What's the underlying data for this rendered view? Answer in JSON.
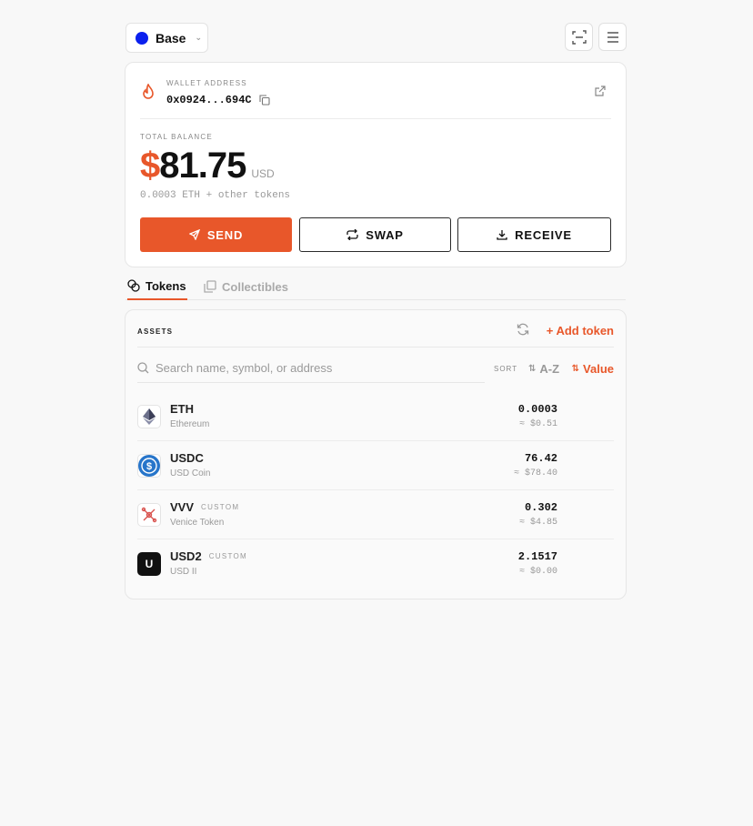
{
  "network": {
    "name": "Base",
    "color": "#0b20ee",
    "chevron_icon": "chevron-down-icon"
  },
  "toolbar": {
    "scan_icon": "scan-icon",
    "menu_icon": "menu-icon"
  },
  "wallet": {
    "address_label": "WALLET ADDRESS",
    "address": "0x0924...694C",
    "balance_label": "TOTAL BALANCE",
    "balance_symbol": "$",
    "balance_amount": "81.75",
    "balance_currency": "USD",
    "balance_sub": "0.0003 ETH + other tokens"
  },
  "actions": {
    "send": "SEND",
    "swap": "SWAP",
    "receive": "RECEIVE"
  },
  "tabs": [
    {
      "label": "Tokens",
      "active": true
    },
    {
      "label": "Collectibles",
      "active": false
    }
  ],
  "assets": {
    "title": "ASSETS",
    "add_token": "+ Add token",
    "search_placeholder": "Search name, symbol, or address",
    "sort_label": "SORT",
    "sort_az": "A-Z",
    "sort_value": "Value",
    "tokens": [
      {
        "symbol": "ETH",
        "name": "Ethereum",
        "amount": "0.0003",
        "usd": "≈ $0.51",
        "custom": ""
      },
      {
        "symbol": "USDC",
        "name": "USD Coin",
        "amount": "76.42",
        "usd": "≈ $78.40",
        "custom": ""
      },
      {
        "symbol": "VVV",
        "name": "Venice Token",
        "amount": "0.302",
        "usd": "≈ $4.85",
        "custom": "CUSTOM"
      },
      {
        "symbol": "USD2",
        "name": "USD II",
        "amount": "2.1517",
        "usd": "≈ $0.00",
        "custom": "CUSTOM",
        "icon_letter": "U"
      }
    ]
  },
  "colors": {
    "accent": "#e8572a"
  }
}
